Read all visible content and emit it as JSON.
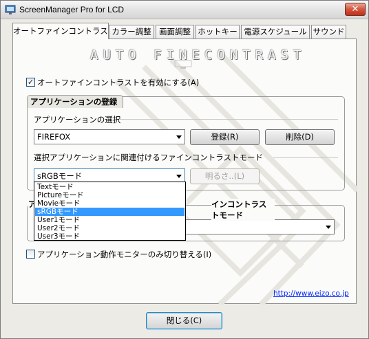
{
  "window": {
    "title": "ScreenManager Pro for LCD",
    "close_label": "✕"
  },
  "tabs": [
    {
      "label": "オートファインコントラスト",
      "active": true
    },
    {
      "label": "カラー調整",
      "active": false
    },
    {
      "label": "画面調整",
      "active": false
    },
    {
      "label": "ホットキー",
      "active": false
    },
    {
      "label": "電源スケジュール",
      "active": false
    },
    {
      "label": "サウンド",
      "active": false
    }
  ],
  "banner": {
    "text": "AUTO FINECONTRAST"
  },
  "enable_checkbox": {
    "label": "オートファインコントラストを有効にする(A)",
    "checked": true,
    "check_mark": "✓"
  },
  "app_group": {
    "title": "アプリケーションの登録",
    "select_label": "アプリケーションの選択",
    "app_value": "FIREFOX",
    "register_label": "登録(R)",
    "delete_label": "削除(D)",
    "mode_label": "選択アプリケーションに関連付けるファインコントラストモード",
    "mode_value": "sRGBモード",
    "brightness_label": "明るさ..(L)"
  },
  "dropdown": {
    "options": [
      "Textモード",
      "Pictureモード",
      "Movieモード",
      "sRGBモード",
      "User1モード",
      "User2モード",
      "User3モード"
    ],
    "selected_index": 3
  },
  "group2": {
    "title_visible_part": "ア",
    "title_right_part": "インコントラストモード"
  },
  "monitor_checkbox": {
    "label": "アプリケーション動作モニターのみ切り替える(I)",
    "checked": false
  },
  "link": {
    "text": "http://www.eizo.co.jp"
  },
  "close_button": {
    "label": "閉じる(C)"
  },
  "colors": {
    "selection": "#3399ff",
    "link": "#0026ff",
    "close_red": "#c0301a"
  }
}
